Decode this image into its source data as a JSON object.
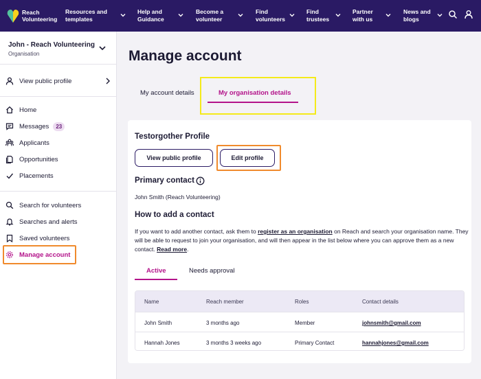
{
  "brand": {
    "line1": "Reach",
    "line2": "Volunteering",
    "colors": {
      "nav": "#2a1a64",
      "accent": "#b3138a",
      "highlight_orange": "#f08a2c",
      "highlight_yellow": "#f4ea1a"
    }
  },
  "nav": {
    "items": [
      {
        "label": "Resources and\ntemplates"
      },
      {
        "label": "Help and\nGuidance"
      },
      {
        "label": "Become a\nvolunteer"
      },
      {
        "label": "Find\nvolunteers"
      },
      {
        "label": "Find\ntrustees"
      },
      {
        "label": "Partner\nwith us"
      },
      {
        "label": "News and\nblogs"
      }
    ],
    "icons": [
      "search-icon",
      "user-icon"
    ]
  },
  "sidebar": {
    "account_name": "John - Reach Volunteering",
    "account_role": "Organisation",
    "view_public_profile": "View public profile",
    "items": [
      {
        "label": "Home",
        "icon": "home-icon"
      },
      {
        "label": "Messages",
        "icon": "message-icon",
        "badge": "23"
      },
      {
        "label": "Applicants",
        "icon": "people-icon"
      },
      {
        "label": "Opportunities",
        "icon": "documents-icon"
      },
      {
        "label": "Placements",
        "icon": "check-icon"
      }
    ],
    "items2": [
      {
        "label": "Search for volunteers",
        "icon": "search-icon"
      },
      {
        "label": "Searches and alerts",
        "icon": "bell-icon"
      },
      {
        "label": "Saved volunteers",
        "icon": "bookmark-icon"
      },
      {
        "label": "Manage account",
        "icon": "gear-icon",
        "active": true
      }
    ]
  },
  "main": {
    "title": "Manage account",
    "tabs": [
      {
        "label": "My account details"
      },
      {
        "label": "My organisation details",
        "active": true
      }
    ],
    "profile_heading": "Testorgother Profile",
    "buttons": {
      "view": "View public profile",
      "edit": "Edit profile"
    },
    "primary_contact_heading": "Primary contact",
    "primary_contact_value": "John Smith (Reach Volunteering)",
    "add_contact_heading": "How to add a contact",
    "add_contact_text_1": "If you want to add another contact, ask them to ",
    "add_contact_link": "register as an organisation",
    "add_contact_text_2": " on Reach and search your organisation name. They will be able to request to join your organisation, and will then appear in the list below where you can approve them as a new contact. ",
    "read_more": "Read more",
    "read_more_suffix": ".",
    "contact_tabs": [
      {
        "label": "Active",
        "active": true
      },
      {
        "label": "Needs approval"
      }
    ],
    "table": {
      "headers": [
        "Name",
        "Reach member",
        "Roles",
        "Contact details"
      ],
      "rows": [
        [
          "John Smith",
          "3 months ago",
          "Member",
          "johnsmith@gmail.com"
        ],
        [
          "Hannah Jones",
          "3 months 3 weeks ago",
          "Primary Contact",
          "hannahjones@gmail.com"
        ]
      ]
    }
  }
}
